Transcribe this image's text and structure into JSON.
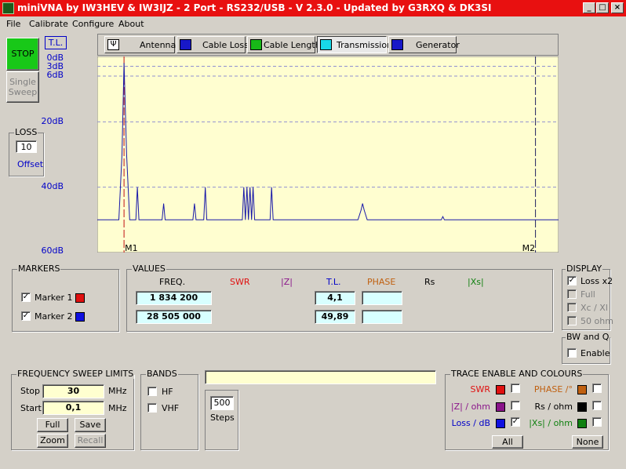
{
  "window": {
    "title": "miniVNA by IW3HEV & IW3IJZ - 2 Port - RS232/USB - V 2.3.0 - Updated by G3RXQ & DK3SI"
  },
  "menu": [
    "File",
    "Calibrate",
    "Configure",
    "About"
  ],
  "left": {
    "stop_label": "STOP",
    "single_sweep_label": "Single Sweep",
    "tl_label": "T.L."
  },
  "loss": {
    "title": "LOSS",
    "value": "10",
    "offset_label": "Offset"
  },
  "tabs": [
    {
      "label": "Antenna",
      "icon": "antenna-icon"
    },
    {
      "label": "Cable Loss",
      "icon": "cable-loss-icon"
    },
    {
      "label": "Cable Length",
      "icon": "cable-length-icon"
    },
    {
      "label": "Transmission",
      "icon": "transmission-icon"
    },
    {
      "label": "Generator",
      "icon": "generator-icon"
    }
  ],
  "axis_labels": [
    "0dB",
    "3dB",
    "6dB",
    "20dB",
    "40dB",
    "60dB"
  ],
  "chart_data": {
    "type": "line",
    "xlim": [
      0.1,
      30
    ],
    "ylim": [
      0,
      60
    ],
    "y_inverted": true,
    "ylabel_unit": "dB",
    "ticks": [
      0,
      3,
      6,
      20,
      40,
      60
    ],
    "grid": true,
    "series": [
      {
        "x": [
          0.1,
          1.5,
          1.7,
          1.834,
          2.0,
          2.2,
          2.3,
          2.6,
          2.7,
          2.8,
          3.0,
          3.2,
          3.3,
          3.5,
          4.3,
          4.4,
          4.5,
          4.6,
          6.3,
          6.4,
          6.5,
          7.0,
          7.1,
          7.2,
          8.5,
          9.5,
          9.6,
          9.7,
          9.8,
          9.9,
          10.0,
          10.1,
          10.2,
          10.3,
          10.4,
          11.3,
          11.4,
          11.5,
          14.0,
          17.0,
          17.2,
          17.3,
          17.4,
          17.6,
          22.4,
          22.5,
          22.6,
          28.5,
          30.0
        ],
        "y": [
          50,
          50,
          30,
          2,
          30,
          50,
          50,
          50,
          40,
          50,
          50,
          50,
          50,
          50,
          50,
          45,
          50,
          50,
          50,
          45,
          50,
          50,
          40,
          50,
          50,
          50,
          40,
          50,
          40,
          50,
          40,
          50,
          40,
          50,
          50,
          50,
          40,
          50,
          50,
          50,
          47,
          45,
          47,
          50,
          50,
          49,
          50,
          50,
          50
        ]
      }
    ],
    "markers": [
      {
        "label": "M1",
        "freq": 1.8342
      },
      {
        "label": "M2",
        "freq": 28.505
      }
    ]
  },
  "markers_group": {
    "title": "MARKERS",
    "marker1": "Marker 1",
    "marker2": "Marker 2",
    "marker1_color": "#e01010",
    "marker2_color": "#1010e0"
  },
  "values": {
    "title": "VALUES",
    "headers": {
      "freq": "FREQ.",
      "swr": "SWR",
      "z": "|Z|",
      "tl": "T.L.",
      "phase": "PHASE",
      "rs": "Rs",
      "xs": "|Xs|"
    },
    "row1": {
      "freq": "1 834 200",
      "tl": "4,1",
      "phase": ""
    },
    "row2": {
      "freq": "28 505 000",
      "tl": "49,89",
      "phase": ""
    }
  },
  "display": {
    "title": "DISPLAY",
    "loss_x2": "Loss x2",
    "full": "Full",
    "xc_xl": "Xc / Xl",
    "fifty_ohm": "50 ohm"
  },
  "bwq": {
    "title": "BW and Q",
    "enable": "Enable"
  },
  "sweep": {
    "title": "FREQUENCY SWEEP LIMITS",
    "stop_label": "Stop",
    "stop_value": "30",
    "start_label": "Start",
    "start_value": "0,1",
    "unit": "MHz",
    "full": "Full",
    "save": "Save",
    "zoom": "Zoom",
    "recall": "Recall"
  },
  "bands": {
    "title": "BANDS",
    "hf": "HF",
    "vhf": "VHF"
  },
  "steps": {
    "value": "500",
    "label": "Steps"
  },
  "trace": {
    "title": "TRACE ENABLE AND COLOURS",
    "swr": "SWR",
    "z": "|Z| / ohm",
    "loss": "Loss / dB",
    "phase": "PHASE /°",
    "rs": "Rs / ohm",
    "xs": "|Xs| / ohm",
    "all": "All",
    "none": "None",
    "colors": {
      "swr": "#e01010",
      "z": "#8a148a",
      "loss": "#1010e0",
      "phase": "#c06010",
      "rs": "#000000",
      "xs": "#108010"
    }
  },
  "colors": {
    "swr_text": "#e01010",
    "z_text": "#8a148a",
    "tl_text": "#0000c8",
    "phase_text": "#c06010",
    "xs_text": "#108010",
    "title_bg": "#e81010",
    "stop_bg": "#18c818"
  }
}
